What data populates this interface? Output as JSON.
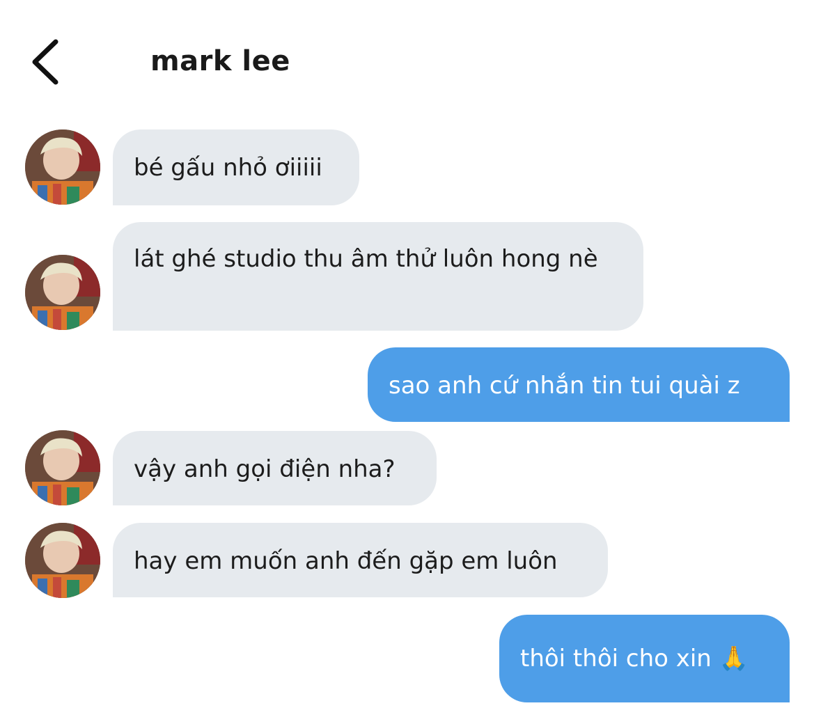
{
  "header": {
    "back_icon": "chevron-left-icon",
    "title": "mark lee"
  },
  "contact": {
    "avatar": "profile-photo"
  },
  "messages": [
    {
      "sender": "them",
      "text": "bé gấu nhỏ ơiiiii"
    },
    {
      "sender": "them",
      "text": "lát ghé studio thu âm thử luôn hong nè"
    },
    {
      "sender": "me",
      "text": "sao anh cứ nhắn tin tui quài z"
    },
    {
      "sender": "them",
      "text": "vậy anh gọi điện nha?"
    },
    {
      "sender": "them",
      "text": "hay em muốn anh đến gặp em luôn"
    },
    {
      "sender": "me",
      "text": "thôi thôi cho xin 🙏"
    }
  ],
  "colors": {
    "incoming_bubble": "#e6eaee",
    "outgoing_bubble": "#4e9ee8",
    "outgoing_text": "#ffffff",
    "incoming_text": "#1c1c1c"
  }
}
